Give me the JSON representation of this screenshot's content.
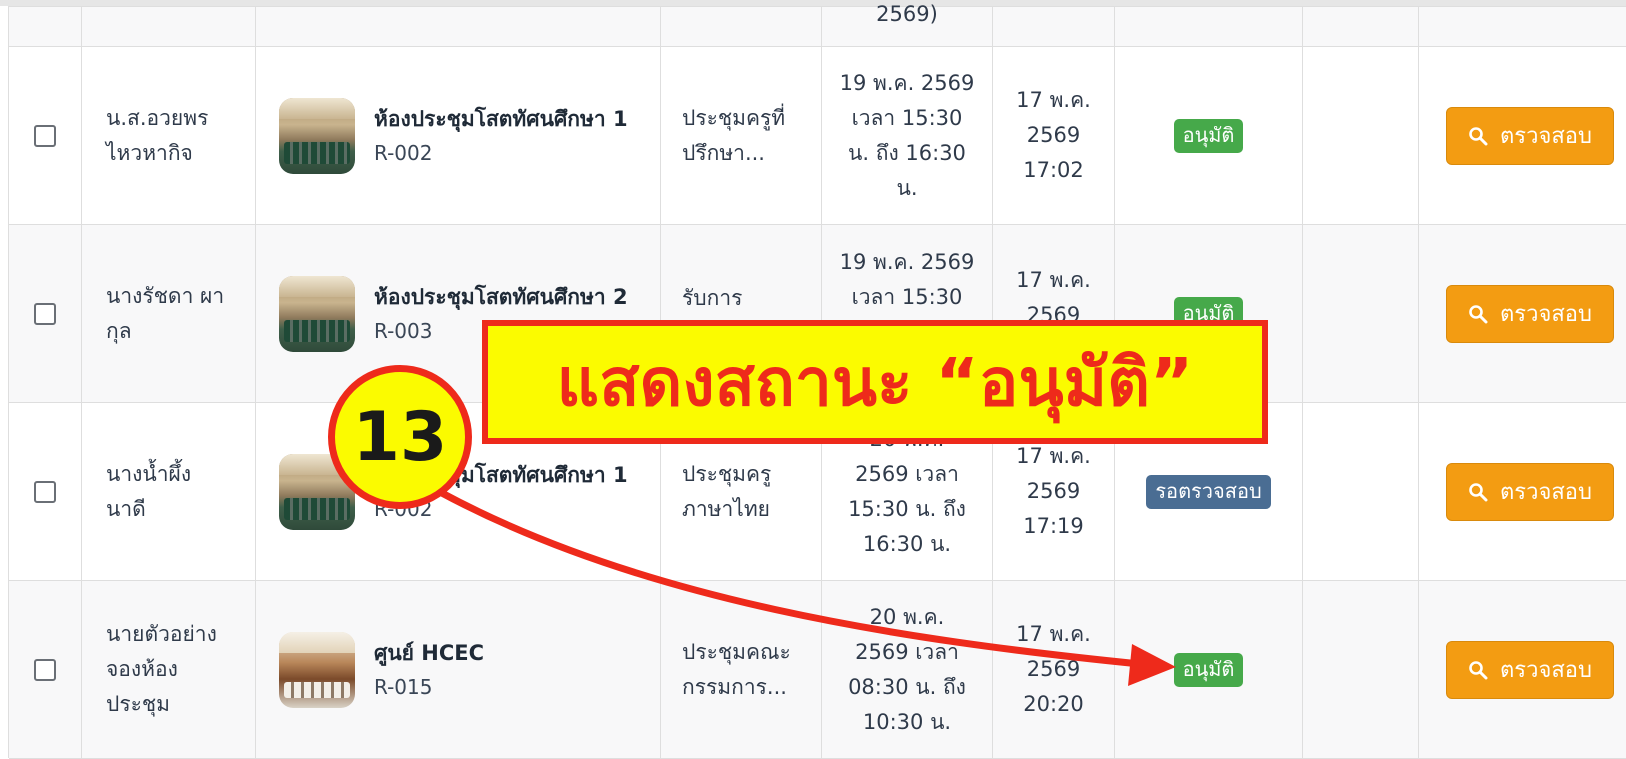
{
  "rows": [
    {
      "partial": true,
      "date_tail": "2569)"
    },
    {
      "name_lines": [
        "น.ส.อวยพร",
        "ไหวหากิจ"
      ],
      "room_name": "ห้องประชุมโสตทัศนศึกษา 1",
      "room_code": "R-002",
      "purpose_lines": [
        "ประชุมครูที่",
        "ปรึกษา..."
      ],
      "date_lines": [
        "19 พ.ค. 2569",
        "เวลา 15:30",
        "น. ถึง 16:30",
        "น."
      ],
      "created_lines": [
        "17 พ.ค.",
        "2569",
        "17:02"
      ],
      "status": "อนุมัติ",
      "status_color": "#46a94a",
      "action": "ตรวจสอบ"
    },
    {
      "name_lines": [
        "นางรัชดา ผา",
        "กุล"
      ],
      "room_name": "ห้องประชุมโสตทัศนศึกษา 2",
      "room_code": "R-003",
      "purpose_lines": [
        "รับการ"
      ],
      "date_lines": [
        "19 พ.ค. 2569",
        "เวลา 15:30"
      ],
      "created_lines": [
        "17 พ.ค.",
        "2569"
      ],
      "status": "อนุมัติ",
      "status_color": "#46a94a",
      "action": "ตรวจสอบ"
    },
    {
      "name_lines": [
        "นางน้ำผึ้ง",
        "นาดี"
      ],
      "room_name": "ห้องประชุมโสตทัศนศึกษา 1",
      "room_code": "R-002",
      "purpose_lines": [
        "ประชุมครู",
        "ภาษาไทย"
      ],
      "date_lines": [
        "20 พ.ค.",
        "2569 เวลา",
        "15:30 น. ถึง",
        "16:30 น."
      ],
      "created_lines": [
        "17 พ.ค.",
        "2569",
        "17:19"
      ],
      "status": "รอตรวจสอบ",
      "status_color": "#4a6d93",
      "action": "ตรวจสอบ"
    },
    {
      "name_lines": [
        "นายตัวอย่าง",
        "จองห้อง",
        "ประชุม"
      ],
      "room_name": "ศูนย์ HCEC",
      "room_code": "R-015",
      "purpose_lines": [
        "ประชุมคณะ",
        "กรรมการ..."
      ],
      "date_lines": [
        "20 พ.ค.",
        "2569 เวลา",
        "08:30 น. ถึง",
        "10:30 น."
      ],
      "created_lines": [
        "17 พ.ค.",
        "2569",
        "20:20"
      ],
      "status": "อนุมัติ",
      "status_color": "#46a94a",
      "action": "ตรวจสอบ"
    }
  ],
  "annotation": {
    "step_number": "13",
    "callout_text": "แสดงสถานะ “อนุมัติ”",
    "color_red": "#ee2a1b",
    "color_yellow": "#fbfb00"
  },
  "icons": {
    "action": "search-icon"
  }
}
